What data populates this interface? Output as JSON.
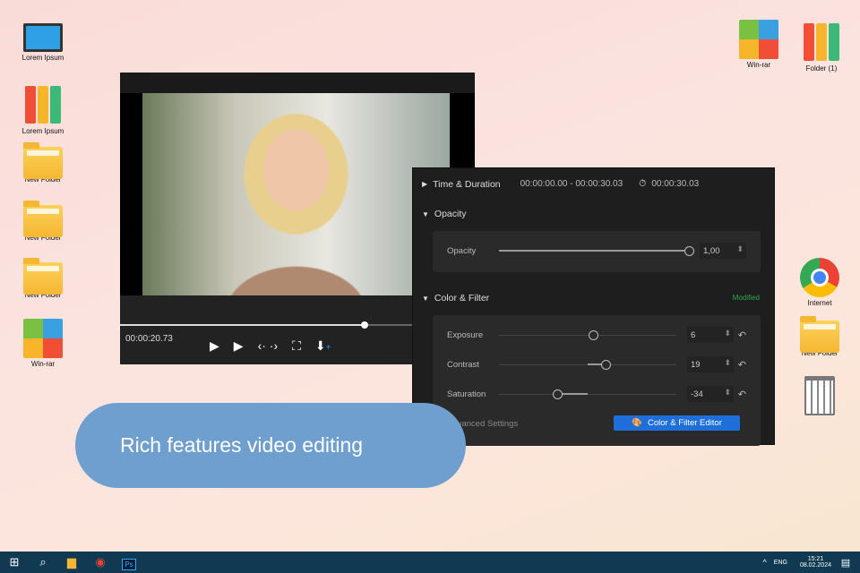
{
  "desktop": {
    "left_icons": [
      {
        "label": "Lorem Ipsum",
        "icon": "computer-icon"
      },
      {
        "label": "Lorem Ipsum",
        "icon": "binders-icon"
      },
      {
        "label": "New Folder",
        "icon": "folder-icon"
      },
      {
        "label": "New Folder",
        "icon": "folder-icon"
      },
      {
        "label": "New Folder",
        "icon": "folder-icon"
      },
      {
        "label": "Win-rar",
        "icon": "winrar-icon"
      }
    ],
    "right_icons": [
      {
        "label": "Win-rar",
        "icon": "winrar-icon"
      },
      {
        "label": "Folder (1)",
        "icon": "binders-icon"
      },
      {
        "label": "Internet",
        "icon": "chrome-icon"
      },
      {
        "label": "New Folder",
        "icon": "folder-icon"
      },
      {
        "label": "",
        "icon": "trash-icon"
      }
    ]
  },
  "player": {
    "current_time": "00:00:20.73",
    "progress_percent": 69
  },
  "panel": {
    "time_duration": {
      "label": "Time & Duration",
      "range": "00:00:00.00 - 00:00:30.03",
      "duration": "00:00:30.03"
    },
    "opacity": {
      "section": "Opacity",
      "label": "Opacity",
      "value": "1,00",
      "slider_percent": 100
    },
    "color_filter": {
      "section": "Color & Filter",
      "status": "Modified",
      "status_color": "#2fa84f",
      "rows": [
        {
          "label": "Exposure",
          "value": "6",
          "slider_percent": 53
        },
        {
          "label": "Contrast",
          "value": "19",
          "slider_percent": 60
        },
        {
          "label": "Saturation",
          "value": "-34",
          "slider_percent": 33
        }
      ],
      "advanced": "Advanced Settings",
      "editor_button": "Color & Filter Editor"
    }
  },
  "banner": "Rich features video editing",
  "taskbar": {
    "lang": "ENG",
    "time": "15:21",
    "date": "08.02.2024"
  }
}
